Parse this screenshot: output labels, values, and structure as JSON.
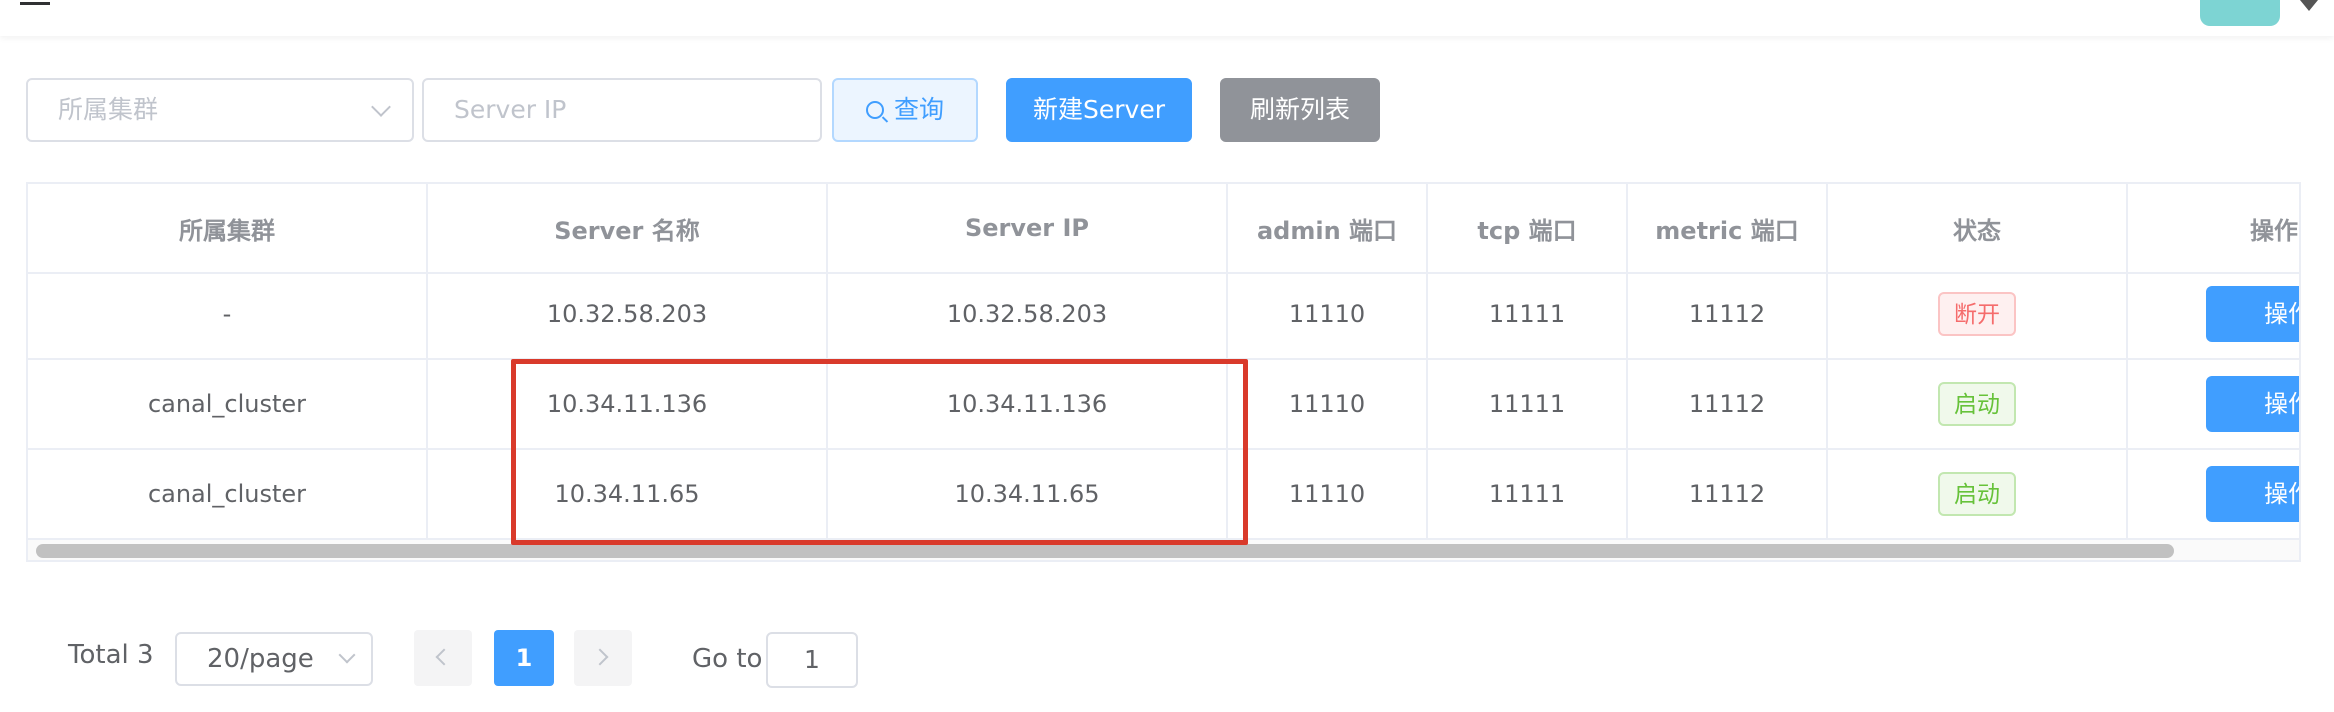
{
  "filters": {
    "cluster_placeholder": "所属集群",
    "server_ip_placeholder": "Server IP",
    "query_label": "查询",
    "new_server_label": "新建Server",
    "refresh_label": "刷新列表"
  },
  "table": {
    "headers": [
      "所属集群",
      "Server 名称",
      "Server IP",
      "admin 端口",
      "tcp 端口",
      "metric 端口",
      "状态",
      "操作"
    ],
    "rows": [
      {
        "cluster": "-",
        "name": "10.32.58.203",
        "ip": "10.32.58.203",
        "admin_port": "11110",
        "tcp_port": "11111",
        "metric_port": "11112",
        "status": "断开",
        "action": "操作"
      },
      {
        "cluster": "canal_cluster",
        "name": "10.34.11.136",
        "ip": "10.34.11.136",
        "admin_port": "11110",
        "tcp_port": "11111",
        "metric_port": "11112",
        "status": "启动",
        "action": "操作"
      },
      {
        "cluster": "canal_cluster",
        "name": "10.34.11.65",
        "ip": "10.34.11.65",
        "admin_port": "11110",
        "tcp_port": "11111",
        "metric_port": "11112",
        "status": "启动",
        "action": "操作"
      }
    ]
  },
  "pagination": {
    "total": "Total 3",
    "page_size": "20/page",
    "current_page": "1",
    "goto_label": "Go to",
    "goto_value": "1"
  },
  "colors": {
    "primary": "#409eff",
    "danger": "#f56c6c",
    "success": "#67c23a",
    "highlight": "#d93a2b"
  }
}
